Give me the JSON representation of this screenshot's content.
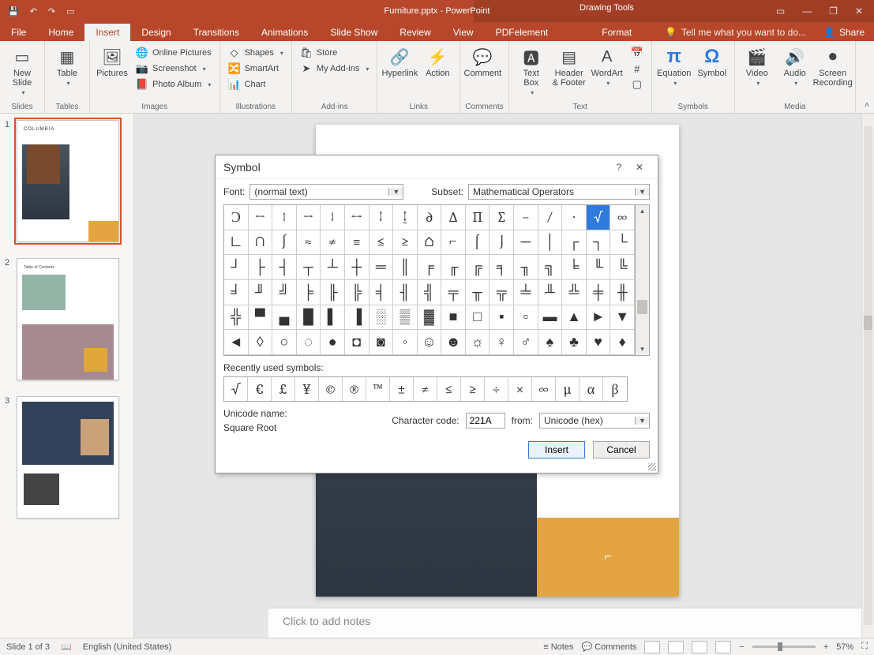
{
  "app": {
    "title": "Furniture.pptx - PowerPoint",
    "context_tab": "Drawing Tools"
  },
  "qat": [
    "save-icon",
    "undo-icon",
    "redo-icon",
    "start-icon"
  ],
  "window_controls": [
    "ribbon-opts",
    "min",
    "restore",
    "close"
  ],
  "tabs": {
    "items": [
      "File",
      "Home",
      "Insert",
      "Design",
      "Transitions",
      "Animations",
      "Slide Show",
      "Review",
      "View",
      "PDFelement",
      "Format"
    ],
    "active": "Insert",
    "tell_me": "Tell me what you want to do...",
    "share": "Share"
  },
  "ribbon": {
    "groups": [
      {
        "label": "Slides",
        "big": [
          {
            "name": "new-slide",
            "label": "New\nSlide",
            "drop": true
          }
        ]
      },
      {
        "label": "Tables",
        "big": [
          {
            "name": "table",
            "label": "Table",
            "drop": true
          }
        ]
      },
      {
        "label": "Images",
        "big": [
          {
            "name": "pictures",
            "label": "Pictures"
          }
        ],
        "stack": [
          {
            "name": "online-pictures",
            "label": "Online Pictures"
          },
          {
            "name": "screenshot",
            "label": "Screenshot",
            "drop": true
          },
          {
            "name": "photo-album",
            "label": "Photo Album",
            "drop": true
          }
        ]
      },
      {
        "label": "Illustrations",
        "stack": [
          {
            "name": "shapes",
            "label": "Shapes",
            "drop": true
          },
          {
            "name": "smartart",
            "label": "SmartArt"
          },
          {
            "name": "chart",
            "label": "Chart"
          }
        ]
      },
      {
        "label": "Add-ins",
        "stack": [
          {
            "name": "store",
            "label": "Store"
          },
          {
            "name": "my-addins",
            "label": "My Add-ins",
            "drop": true
          }
        ]
      },
      {
        "label": "Links",
        "big": [
          {
            "name": "hyperlink",
            "label": "Hyperlink"
          },
          {
            "name": "action",
            "label": "Action"
          }
        ]
      },
      {
        "label": "Comments",
        "big": [
          {
            "name": "comment",
            "label": "Comment"
          }
        ]
      },
      {
        "label": "Text",
        "big": [
          {
            "name": "text-box",
            "label": "Text\nBox",
            "drop": true
          },
          {
            "name": "header-footer",
            "label": "Header\n& Footer"
          },
          {
            "name": "wordart",
            "label": "WordArt",
            "drop": true
          }
        ],
        "mini": [
          "date-time",
          "slide-number",
          "object"
        ]
      },
      {
        "label": "Symbols",
        "big": [
          {
            "name": "equation",
            "label": "Equation",
            "drop": true
          },
          {
            "name": "symbol",
            "label": "Symbol"
          }
        ]
      },
      {
        "label": "Media",
        "big": [
          {
            "name": "video",
            "label": "Video",
            "drop": true
          },
          {
            "name": "audio",
            "label": "Audio",
            "drop": true
          },
          {
            "name": "screen-recording",
            "label": "Screen\nRecording"
          }
        ]
      }
    ]
  },
  "slides": [
    {
      "n": "1",
      "title": "COLUMBIA"
    },
    {
      "n": "2",
      "title": "Table of Contents"
    },
    {
      "n": "3",
      "title": ""
    }
  ],
  "notes_placeholder": "Click to add notes",
  "status": {
    "slide_pos": "Slide 1 of 3",
    "lang": "English (United States)",
    "notes_btn": "Notes",
    "comments_btn": "Comments",
    "zoom": "57%"
  },
  "dialog": {
    "title": "Symbol",
    "font_label": "Font:",
    "font_value": "(normal text)",
    "subset_label": "Subset:",
    "subset_value": "Mathematical Operators",
    "recent_label": "Recently used symbols:",
    "unicode_name_label": "Unicode name:",
    "unicode_name_value": "Square Root",
    "charcode_label": "Character code:",
    "charcode_value": "221A",
    "from_label": "from:",
    "from_value": "Unicode (hex)",
    "insert": "Insert",
    "cancel": "Cancel",
    "help": "?",
    "grid": [
      "Ɔ",
      "←",
      "↑",
      "→",
      "↓",
      "↔",
      "↕",
      "↨",
      "∂",
      "∆",
      "∏",
      "∑",
      "−",
      "∕",
      "∙",
      "√",
      "∞",
      "∟",
      "∩",
      "∫",
      "≈",
      "≠",
      "≡",
      "≤",
      "≥",
      "⌂",
      "⌐",
      "⌠",
      "⌡",
      "─",
      "│",
      "┌",
      "┐",
      "└",
      "┘",
      "├",
      "┤",
      "┬",
      "┴",
      "┼",
      "═",
      "║",
      "╒",
      "╓",
      "╔",
      "╕",
      "╖",
      "╗",
      "╘",
      "╙",
      "╚",
      "╛",
      "╜",
      "╝",
      "╞",
      "╟",
      "╠",
      "╡",
      "╢",
      "╣",
      "╤",
      "╥",
      "╦",
      "╧",
      "╨",
      "╩",
      "╪",
      "╫",
      "╬",
      "▀",
      "▄",
      "█",
      "▌",
      "▐",
      "░",
      "▒",
      "▓",
      "■",
      "□",
      "▪",
      "▫",
      "▬",
      "▲",
      "►",
      "▼",
      "◄",
      "◊",
      "○",
      "◌",
      "●",
      "◘",
      "◙",
      "◦",
      "☺",
      "☻",
      "☼",
      "♀",
      "♂",
      "♠",
      "♣",
      "♥",
      "♦"
    ],
    "selected_index": 15,
    "recent": [
      "√",
      "€",
      "£",
      "¥",
      "©",
      "®",
      "™",
      "±",
      "≠",
      "≤",
      "≥",
      "÷",
      "×",
      "∞",
      "µ",
      "α",
      "β"
    ]
  }
}
